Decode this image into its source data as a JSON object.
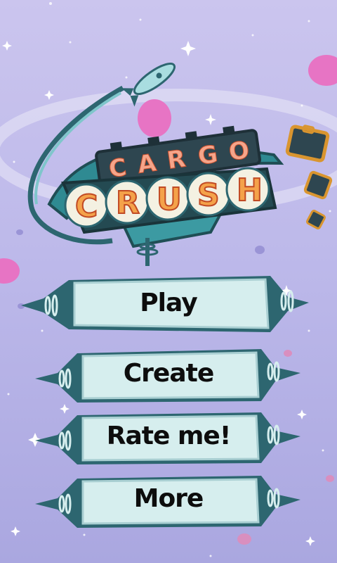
{
  "title": {
    "line1": "CARGO",
    "line2": "CRUSH",
    "line1_letters": [
      "C",
      "A",
      "R",
      "G",
      "O"
    ],
    "line2_letters": [
      "C",
      "R",
      "U",
      "S",
      "H"
    ]
  },
  "menu": {
    "play": "Play",
    "create": "Create",
    "rate": "Rate me!",
    "more": "More"
  },
  "colors": {
    "sky_top": "#cbc5ee",
    "sky_bottom": "#aaa7e0",
    "button_fill": "#d6eeee",
    "button_border": "#2d6670",
    "title_orange": "#f0903a",
    "sign_teal": "#2f8a92"
  },
  "icons": [
    "rocket-icon",
    "suitcase-icon",
    "planet-icon",
    "star-icon"
  ]
}
